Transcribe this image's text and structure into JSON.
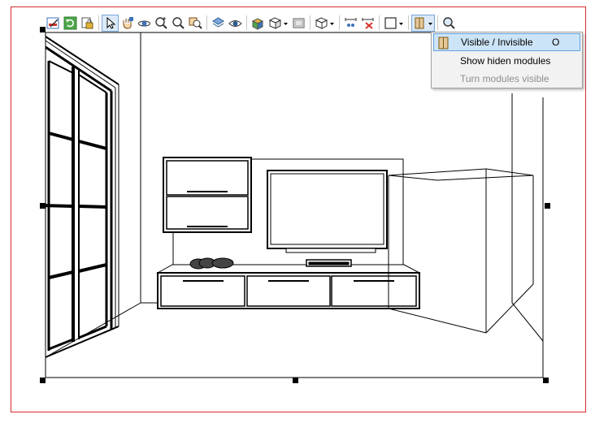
{
  "toolbar": {
    "buttons": [
      {
        "icon": "edit-icon"
      },
      {
        "icon": "refresh-icon"
      },
      {
        "icon": "lock-icon"
      },
      {
        "icon": "select-arrow-icon",
        "active": true
      },
      {
        "icon": "pan-hand-icon"
      },
      {
        "icon": "orbit-icon"
      },
      {
        "icon": "zoom-in-icon"
      },
      {
        "icon": "zoom-icon"
      },
      {
        "icon": "zoom-window-icon"
      },
      {
        "icon": "layers-icon"
      },
      {
        "icon": "eye-icon"
      },
      {
        "icon": "materials-icon"
      },
      {
        "icon": "view-dropdown-icon"
      },
      {
        "icon": "frame-icon"
      },
      {
        "icon": "cube-dropdown-icon"
      },
      {
        "icon": "dimension-icon"
      },
      {
        "icon": "delete-dimension-icon"
      },
      {
        "icon": "rectangle-dropdown-icon"
      },
      {
        "icon": "module-visibility-dropdown-icon",
        "active": true
      },
      {
        "icon": "search-zoom-icon"
      }
    ]
  },
  "menu": {
    "items": [
      {
        "label": "Visible / Invisible",
        "shortcut": "O",
        "highlighted": true,
        "enabled": true,
        "icon": "module-visibility-icon"
      },
      {
        "label": "Show hiden modules",
        "shortcut": "",
        "highlighted": false,
        "enabled": true
      },
      {
        "label": "Turn modules visible",
        "shortcut": "",
        "highlighted": false,
        "enabled": false
      }
    ]
  },
  "colors": {
    "frame_border": "#d62b2b",
    "menu_highlight": "#cce4f7",
    "menu_highlight_border": "#62a2e4",
    "active_button": "#dbe9f8"
  }
}
